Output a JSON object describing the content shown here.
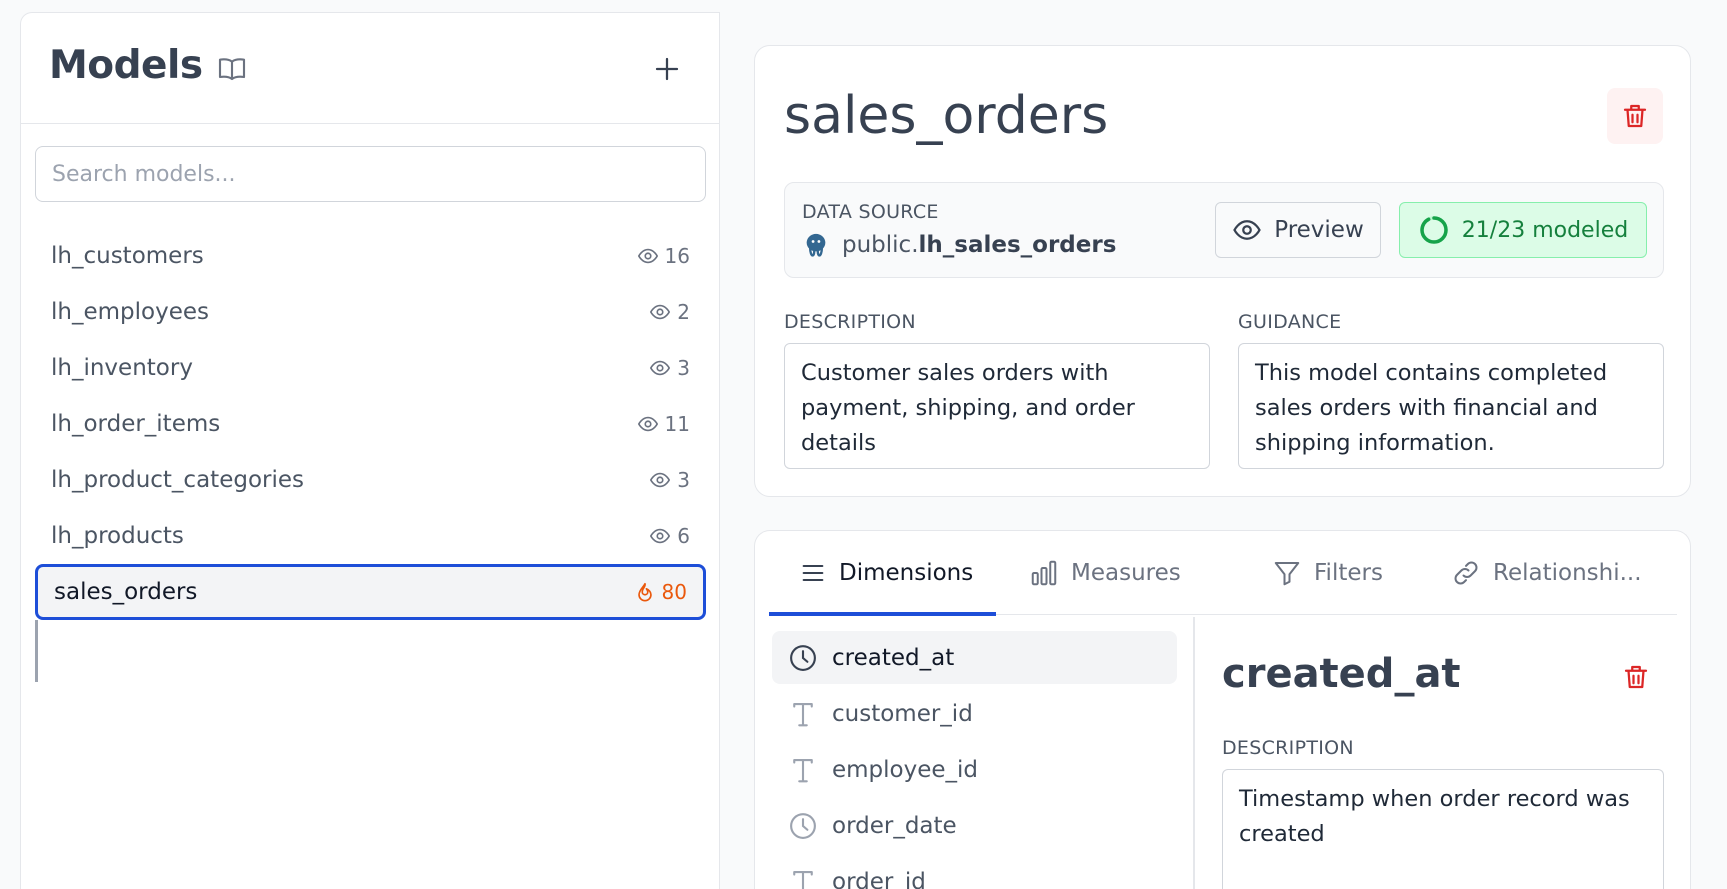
{
  "sidebar": {
    "title": "Models",
    "search_placeholder": "Search models...",
    "models": [
      {
        "name": "lh_customers",
        "count": "16",
        "icon": "eye-icon"
      },
      {
        "name": "lh_employees",
        "count": "2",
        "icon": "eye-icon"
      },
      {
        "name": "lh_inventory",
        "count": "3",
        "icon": "eye-icon"
      },
      {
        "name": "lh_order_items",
        "count": "11",
        "icon": "eye-icon"
      },
      {
        "name": "lh_product_categories",
        "count": "3",
        "icon": "eye-icon"
      },
      {
        "name": "lh_products",
        "count": "6",
        "icon": "eye-icon"
      },
      {
        "name": "sales_orders",
        "count": "80",
        "icon": "flame-icon",
        "selected": true
      }
    ]
  },
  "model": {
    "title": "sales_orders",
    "data_source_label": "DATA SOURCE",
    "data_source_schema": "public.",
    "data_source_table": "lh_sales_orders",
    "preview_label": "Preview",
    "modeled_label": "21/23 modeled",
    "description_label": "DESCRIPTION",
    "description": "Customer sales orders with payment, shipping, and order details",
    "guidance_label": "GUIDANCE",
    "guidance": "This model contains completed sales orders with financial and shipping information."
  },
  "tabs": [
    {
      "label": "Dimensions",
      "icon": "list-icon",
      "active": true
    },
    {
      "label": "Measures",
      "icon": "bar-chart-icon"
    },
    {
      "label": "Filters",
      "icon": "filter-icon"
    },
    {
      "label": "Relationshi...",
      "icon": "link-icon"
    }
  ],
  "dimensions": [
    {
      "name": "created_at",
      "icon": "clock-icon",
      "selected": true
    },
    {
      "name": "customer_id",
      "icon": "text-type-icon"
    },
    {
      "name": "employee_id",
      "icon": "text-type-icon"
    },
    {
      "name": "order_date",
      "icon": "clock-icon"
    },
    {
      "name": "order_id",
      "icon": "text-type-icon"
    }
  ],
  "detail": {
    "title": "created_at",
    "description_label": "DESCRIPTION",
    "description": "Timestamp when order record was created"
  },
  "colors": {
    "accent": "#1d4ed8",
    "danger": "#dc2626",
    "success": "#15803d",
    "flame": "#ea580c"
  }
}
